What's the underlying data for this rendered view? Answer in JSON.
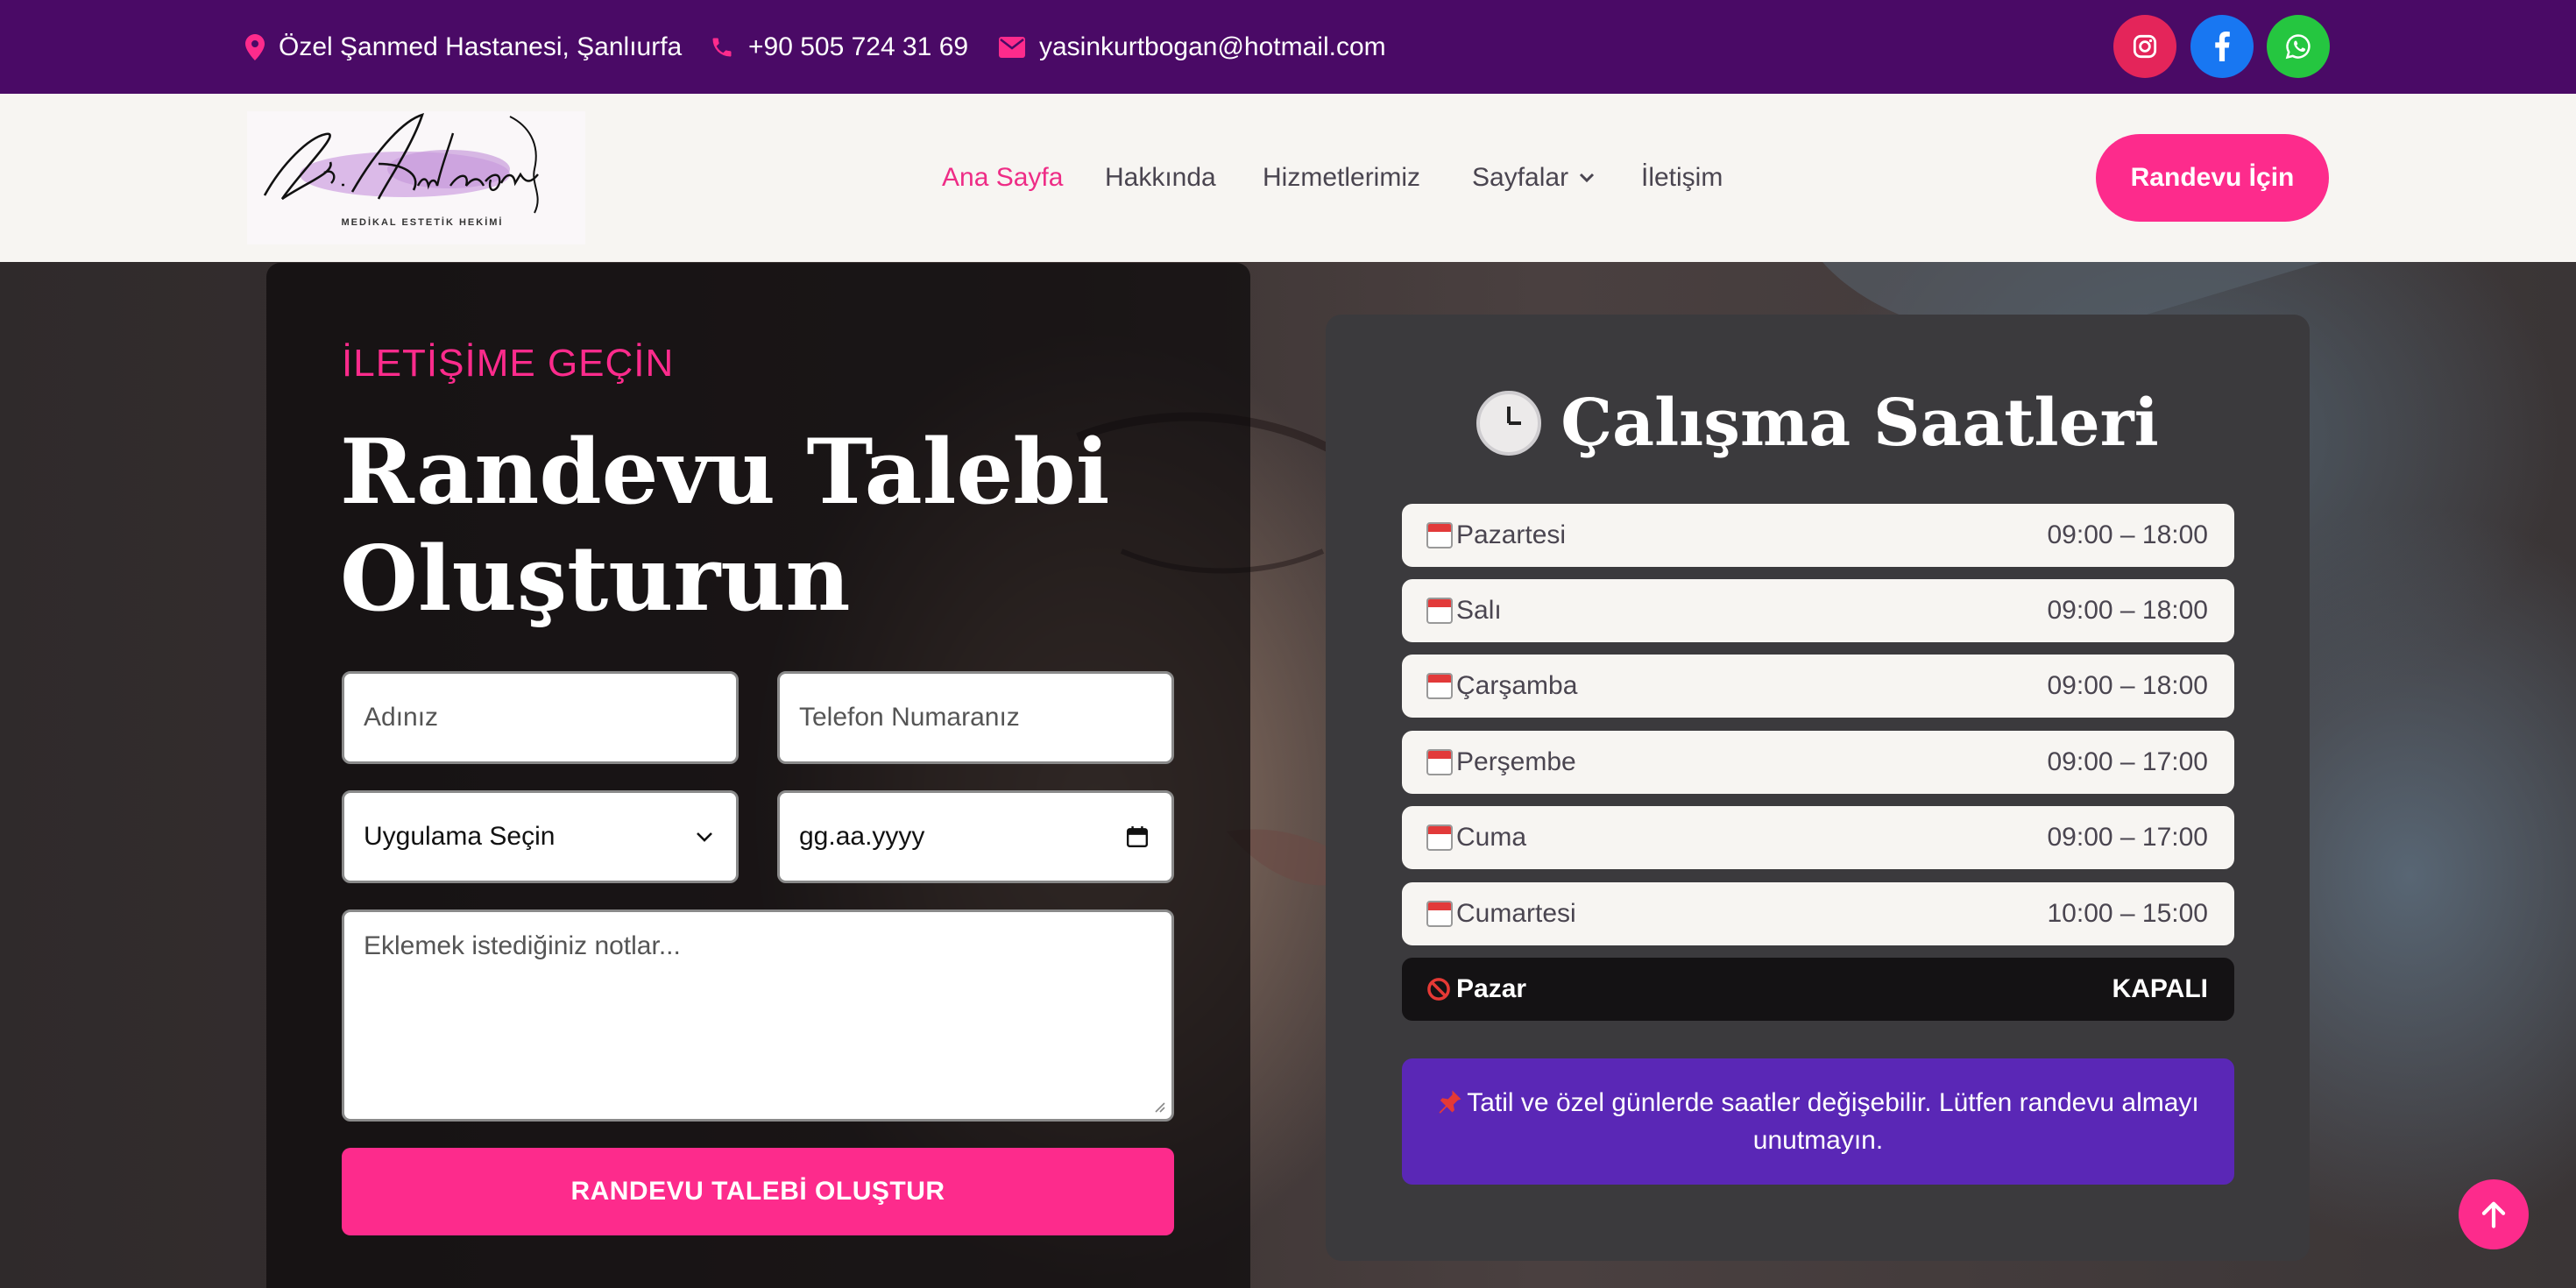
{
  "topbar": {
    "address": "Özel Şanmed Hastanesi, Şanlıurfa",
    "phone": "+90 505 724 31 69",
    "email": "yasinkurtbogan@hotmail.com",
    "social": [
      {
        "name": "instagram-icon",
        "color": "#e4255a"
      },
      {
        "name": "facebook-icon",
        "color": "#1877f2"
      },
      {
        "name": "whatsapp-icon",
        "color": "#25c640"
      }
    ],
    "bg_color": "#4a0a66"
  },
  "nav": {
    "logo_text": "Dr. Kurtboğan",
    "logo_subtitle": "MEDİKAL ESTETİK HEKİMİ",
    "links": [
      "Ana Sayfa",
      "Hakkında",
      "Hizmetlerimiz",
      "Sayfalar",
      "İletişim"
    ],
    "active_index": 0,
    "cta": "Randevu İçin",
    "accent": "#fd2b8c"
  },
  "form": {
    "eyebrow": "İLETİŞİME GEÇİN",
    "title_line1": "Randevu Talebi",
    "title_line2": "Oluşturun",
    "name_placeholder": "Adınız",
    "phone_placeholder": "Telefon Numaranız",
    "treatment_select": "Uygulama Seçin",
    "date_placeholder": "gg.aa.yyyy",
    "notes_placeholder": "Eklemek istediğiniz notlar...",
    "submit": "RANDEVU TALEBİ OLUŞTUR"
  },
  "hours": {
    "title": "Çalışma Saatleri",
    "days": [
      {
        "day": "Pazartesi",
        "time": "09:00 – 18:00"
      },
      {
        "day": "Salı",
        "time": "09:00 – 18:00"
      },
      {
        "day": "Çarşamba",
        "time": "09:00 – 18:00"
      },
      {
        "day": "Perşembe",
        "time": "09:00 – 17:00"
      },
      {
        "day": "Cuma",
        "time": "09:00 – 17:00"
      },
      {
        "day": "Cumartesi",
        "time": "10:00 – 15:00"
      }
    ],
    "closed_day": "Pazar",
    "closed_label": "KAPALI",
    "notice": "Tatil ve özel günlerde saatler değişebilir. Lütfen randevu almayı unutmayın.",
    "notice_color": "#5a27b6"
  }
}
